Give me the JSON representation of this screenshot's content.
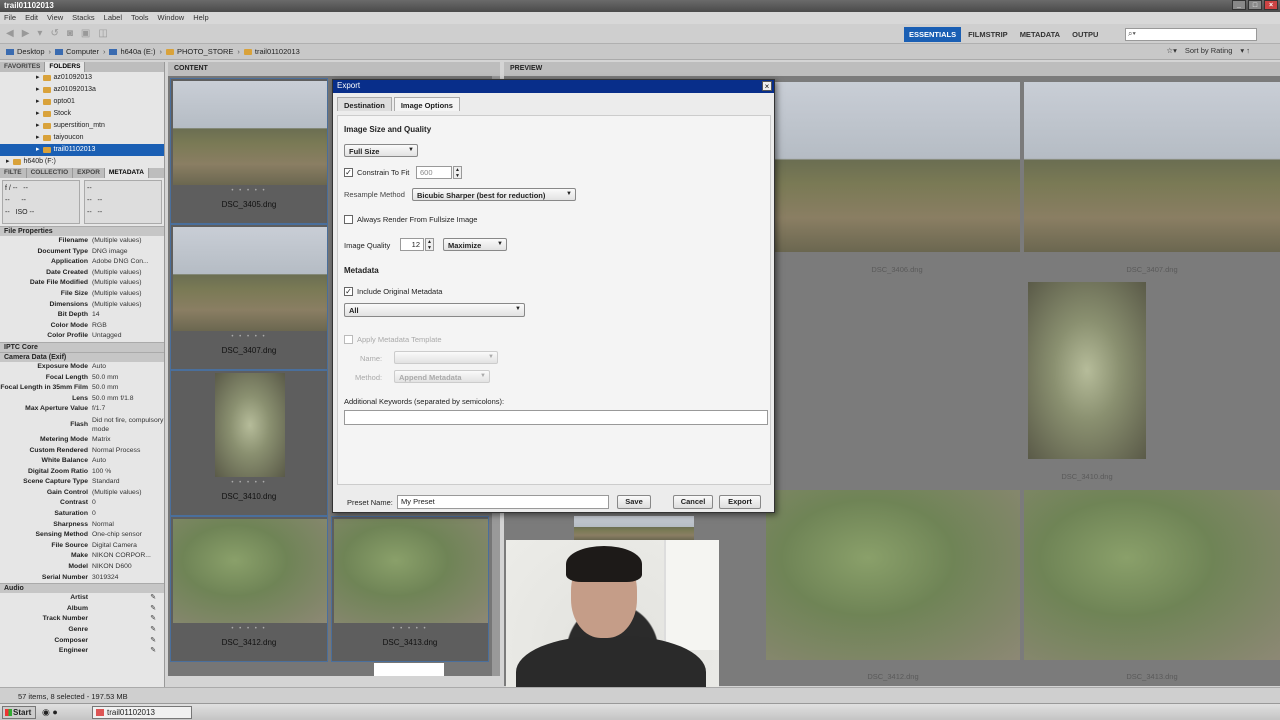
{
  "window": {
    "title": "trail01102013"
  },
  "menu": [
    "File",
    "Edit",
    "View",
    "Stacks",
    "Label",
    "Tools",
    "Window",
    "Help"
  ],
  "workspaces": [
    {
      "label": "ESSENTIALS",
      "active": true
    },
    {
      "label": "FILMSTRIP",
      "active": false
    },
    {
      "label": "METADATA",
      "active": false
    },
    {
      "label": "OUTPU",
      "active": false
    }
  ],
  "search": {
    "placeholder": ""
  },
  "path": [
    "Desktop",
    "Computer",
    "h640a (E:)",
    "PHOTO_STORE",
    "trail01102013"
  ],
  "path_right": {
    "sort": "Sort by Rating"
  },
  "left_tabs": [
    "FAVORITES",
    "FOLDERS"
  ],
  "folders": [
    {
      "label": "az01092013"
    },
    {
      "label": "az01092013a"
    },
    {
      "label": "opto01"
    },
    {
      "label": "Stock"
    },
    {
      "label": "superstition_mtn"
    },
    {
      "label": "taiyoucon"
    },
    {
      "label": "trail01102013",
      "selected": true
    },
    {
      "label": "h640b (F:)"
    }
  ],
  "meta_tabs": [
    "FILTE",
    "COLLECTIO",
    "EXPOR",
    "METADATA"
  ],
  "meta_box": {
    "left": "f / --   --\n--      --\n--   ISO --",
    "right": "--\n--   --\n--   --"
  },
  "sections": {
    "file_properties": "File Properties",
    "iptc": "IPTC Core",
    "camera": "Camera Data (Exif)",
    "audio": "Audio"
  },
  "file_props": [
    [
      "Filename",
      "(Multiple values)"
    ],
    [
      "Document Type",
      "DNG image"
    ],
    [
      "Application",
      "Adobe DNG Con..."
    ],
    [
      "Date Created",
      "(Multiple values)"
    ],
    [
      "Date File Modified",
      "(Multiple values)"
    ],
    [
      "File Size",
      "(Multiple values)"
    ],
    [
      "Dimensions",
      "(Multiple values)"
    ],
    [
      "Bit Depth",
      "14"
    ],
    [
      "Color Mode",
      "RGB"
    ],
    [
      "Color Profile",
      "Untagged"
    ]
  ],
  "camera_props": [
    [
      "Exposure Mode",
      "Auto"
    ],
    [
      "Focal Length",
      "50.0 mm"
    ],
    [
      "Focal Length in 35mm Film",
      "50.0 mm"
    ],
    [
      "Lens",
      "50.0 mm f/1.8"
    ],
    [
      "Max Aperture Value",
      "f/1.7"
    ],
    [
      "Flash",
      "Did not fire, compulsory mode"
    ],
    [
      "Metering Mode",
      "Matrix"
    ],
    [
      "Custom Rendered",
      "Normal Process"
    ],
    [
      "White Balance",
      "Auto"
    ],
    [
      "Digital Zoom Ratio",
      "100 %"
    ],
    [
      "Scene Capture Type",
      "Standard"
    ],
    [
      "Gain Control",
      "(Multiple values)"
    ],
    [
      "Contrast",
      "0"
    ],
    [
      "Saturation",
      "0"
    ],
    [
      "Sharpness",
      "Normal"
    ],
    [
      "Sensing Method",
      "One-chip sensor"
    ],
    [
      "File Source",
      "Digital Camera"
    ],
    [
      "Make",
      "NIKON CORPOR..."
    ],
    [
      "Model",
      "NIKON D600"
    ],
    [
      "Serial Number",
      "3019324"
    ]
  ],
  "audio_props": [
    "Artist",
    "Album",
    "Track Number",
    "Genre",
    "Composer",
    "Engineer"
  ],
  "content": {
    "header": "CONTENT",
    "thumbs": [
      {
        "caption": "DSC_3405.dng",
        "style": "desert"
      },
      {
        "caption": "DSC_3407.dng",
        "style": "desert"
      },
      {
        "caption": "DSC_3410.dng",
        "style": "cactus"
      },
      {
        "caption": "DSC_3412.dng",
        "style": "bush"
      },
      {
        "caption": "DSC_3413.dng",
        "style": "bush"
      }
    ]
  },
  "preview": {
    "header": "PREVIEW",
    "captions": [
      "DSC_3406.dng",
      "DSC_3407.dng",
      "DSC_3410.dng",
      "DSC_3412.dng",
      "DSC_3413.dng"
    ]
  },
  "dialog": {
    "title": "Export",
    "tabs": [
      "Destination",
      "Image Options"
    ],
    "active_tab": "Image Options",
    "size_heading": "Image Size and Quality",
    "size_mode": "Full Size",
    "constrain_label": "Constrain To Fit",
    "constrain_checked": true,
    "constrain_value": "600",
    "resample_label": "Resample Method",
    "resample_value": "Bicubic Sharper (best for reduction)",
    "always_render_label": "Always Render From Fullsize Image",
    "quality_label": "Image Quality",
    "quality_value": "12",
    "quality_preset": "Maximize",
    "metadata_heading": "Metadata",
    "include_meta_label": "Include Original Metadata",
    "include_meta_checked": true,
    "meta_scope": "All",
    "apply_template_label": "Apply Metadata Template",
    "name_label": "Name:",
    "method_label": "Method:",
    "method_value": "Append Metadata",
    "keywords_label": "Additional Keywords (separated by semicolons):",
    "keywords_value": "",
    "preset_label": "Preset Name:",
    "preset_value": "My Preset",
    "save": "Save",
    "cancel": "Cancel",
    "export": "Export"
  },
  "status": "57 items, 8 selected - 197.53 MB",
  "taskbar": {
    "start": "Start",
    "item": "trail01102013"
  }
}
